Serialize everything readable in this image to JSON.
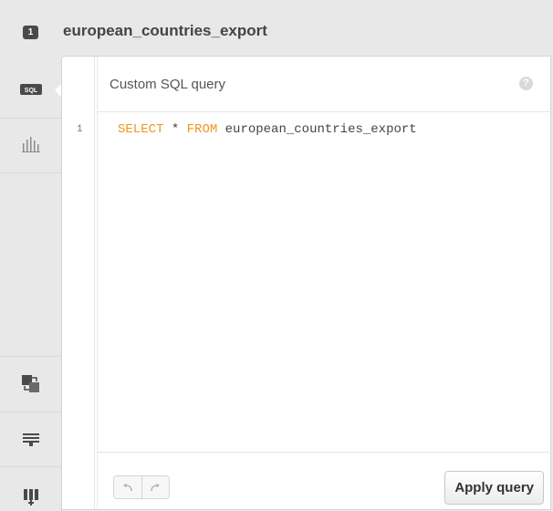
{
  "header": {
    "layer_number": "1",
    "layer_name": "european_countries_export"
  },
  "sidebar": {
    "items": [
      {
        "icon": "sql-icon",
        "label": "SQL",
        "active": true
      },
      {
        "icon": "bar-chart-icon"
      },
      {
        "icon": "merge-icon"
      },
      {
        "icon": "legend-icon"
      },
      {
        "icon": "column-add-icon"
      }
    ]
  },
  "panel": {
    "title": "Custom SQL query",
    "help_label": "?"
  },
  "editor": {
    "line_number": "1",
    "keyword_select": "SELECT",
    "star": " * ",
    "keyword_from": "FROM",
    "table_name": " european_countries_export"
  },
  "footer": {
    "apply_label": "Apply query"
  },
  "colors": {
    "keyword": "#f0961e",
    "background": "#e8e8e8"
  }
}
